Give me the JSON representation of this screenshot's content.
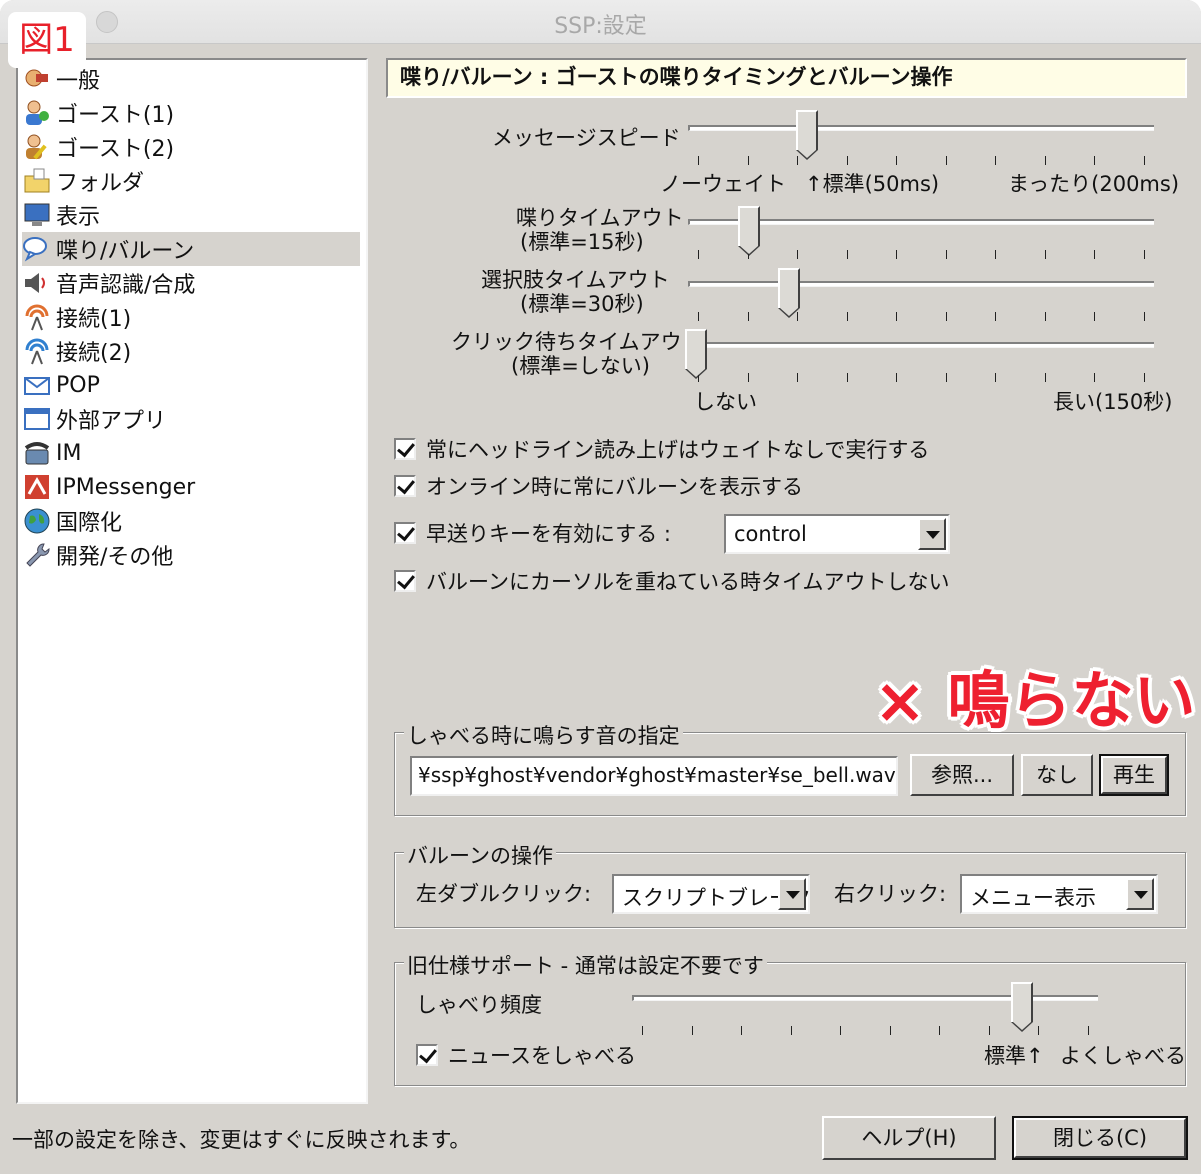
{
  "window": {
    "title": "SSP:設定"
  },
  "figure_label": "図1",
  "sidebar": {
    "items": [
      {
        "label": "一般",
        "icon": "general-icon"
      },
      {
        "label": "ゴースト(1)",
        "icon": "ghost-person-icon"
      },
      {
        "label": "ゴースト(2)",
        "icon": "ghost-person-edit-icon"
      },
      {
        "label": "フォルダ",
        "icon": "folder-icon"
      },
      {
        "label": "表示",
        "icon": "monitor-icon"
      },
      {
        "label": "喋り/バルーン",
        "icon": "speech-balloon-icon",
        "selected": true
      },
      {
        "label": "音声認識/合成",
        "icon": "speaker-icon"
      },
      {
        "label": "接続(1)",
        "icon": "antenna-icon"
      },
      {
        "label": "接続(2)",
        "icon": "antenna-blue-icon"
      },
      {
        "label": "POP",
        "icon": "mail-icon"
      },
      {
        "label": "外部アプリ",
        "icon": "window-icon"
      },
      {
        "label": "IM",
        "icon": "telephone-icon"
      },
      {
        "label": "IPMessenger",
        "icon": "ipmessenger-icon"
      },
      {
        "label": "国際化",
        "icon": "globe-icon"
      },
      {
        "label": "開発/その他",
        "icon": "wrench-icon"
      }
    ]
  },
  "panel": {
    "header": "喋り/バルーン : ゴーストの喋りタイミングとバルーン操作",
    "message_speed": {
      "label": "メッセージスピード",
      "level": 0.25,
      "left_label": "ノーウェイト",
      "mid_label": "↑標準(50ms)",
      "right_label": "まったり(200ms)"
    },
    "talk_timeout": {
      "label1": "喋りタイムアウト",
      "label2": "(標準=15秒)",
      "level": 0.12
    },
    "choice_timeout": {
      "label1": "選択肢タイムアウト",
      "label2": "(標準=30秒)",
      "level": 0.21
    },
    "click_timeout": {
      "label1": "クリック待ちタイムアウト",
      "label2": "(標準=しない)",
      "level": 0.0,
      "left_label": "しない",
      "right_label": "長い(150秒)"
    },
    "checkboxes": [
      {
        "label": "常にヘッドライン読み上げはウェイトなしで実行する",
        "checked": true
      },
      {
        "label": "オンライン時に常にバルーンを表示する",
        "checked": true
      },
      {
        "label": "早送りキーを有効にする :",
        "checked": true
      },
      {
        "label": "バルーンにカーソルを重ねている時タイムアウトしない",
        "checked": true
      }
    ],
    "fast_forward_key": "control",
    "annotation": "× 鳴らない",
    "sound_group": {
      "title": "しゃべる時に鳴らす音の指定",
      "path": "¥ssp¥ghost¥vendor¥ghost¥master¥se_bell.wav",
      "browse": "参照...",
      "none": "なし",
      "play": "再生"
    },
    "balloon_group": {
      "title": "バルーンの操作",
      "left_dbl_label": "左ダブルクリック:",
      "left_dbl_value": "スクリプトブレーク",
      "right_click_label": "右クリック:",
      "right_click_value": "メニュー表示"
    },
    "legacy_group": {
      "title": "旧仕様サポート - 通常は設定不要です",
      "freq_label": "しゃべり頻度",
      "level": 0.86,
      "news_label": "ニュースをしゃべる",
      "news_checked": true,
      "std_label": "標準↑",
      "more_label": "よくしゃべる"
    }
  },
  "footer": {
    "status": "一部の設定を除き、変更はすぐに反映されます。",
    "help": "ヘルプ(H)",
    "close": "閉じる(C)"
  }
}
